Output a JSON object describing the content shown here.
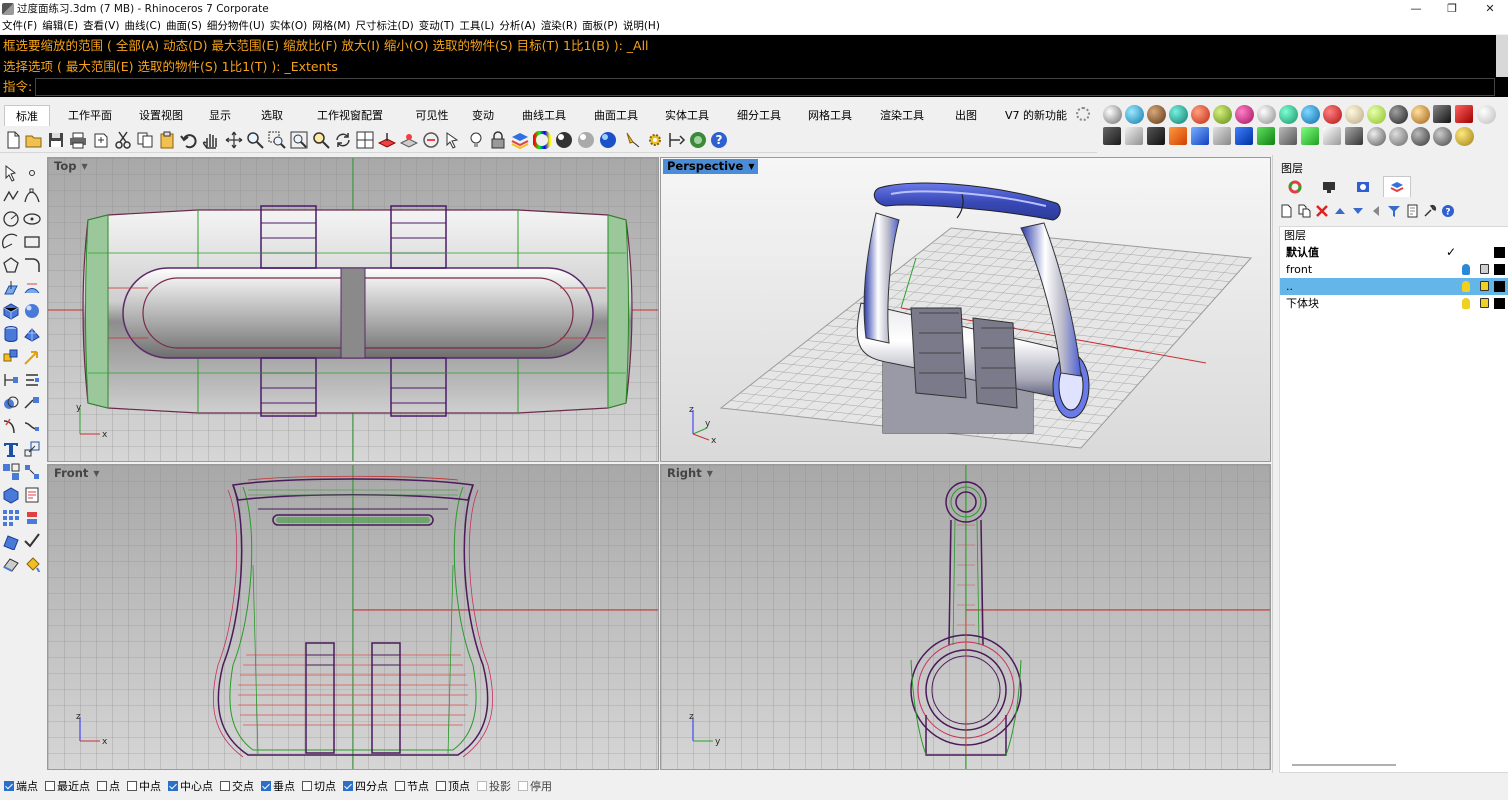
{
  "window": {
    "title": "过度面练习.3dm (7 MB) - Rhinoceros 7 Corporate",
    "controls": {
      "minimize": "—",
      "maximize": "❐",
      "close": "✕"
    }
  },
  "menu": [
    "文件(F)",
    "编辑(E)",
    "查看(V)",
    "曲线(C)",
    "曲面(S)",
    "细分物件(U)",
    "实体(O)",
    "网格(M)",
    "尺寸标注(D)",
    "变动(T)",
    "工具(L)",
    "分析(A)",
    "渲染(R)",
    "面板(P)",
    "说明(H)"
  ],
  "command": {
    "history": [
      "框选要缩放的范围 ( 全部(A)  动态(D)  最大范围(E)  缩放比(F)  放大(I)  缩小(O)  选取的物件(S)  目标(T)  1比1(B) ): _All",
      "选择选项 ( 最大范围(E)  选取的物件(S)  1比1(T) ): _Extents"
    ],
    "prompt": "指令:",
    "value": ""
  },
  "tabs": [
    {
      "label": "标准",
      "active": true
    },
    {
      "label": "工作平面",
      "active": false
    },
    {
      "label": "设置视图",
      "active": false
    },
    {
      "label": "显示",
      "active": false
    },
    {
      "label": "选取",
      "active": false
    },
    {
      "label": "工作视窗配置",
      "active": false
    },
    {
      "label": "可见性",
      "active": false
    },
    {
      "label": "变动",
      "active": false
    },
    {
      "label": "曲线工具",
      "active": false
    },
    {
      "label": "曲面工具",
      "active": false
    },
    {
      "label": "实体工具",
      "active": false
    },
    {
      "label": "细分工具",
      "active": false
    },
    {
      "label": "网格工具",
      "active": false
    },
    {
      "label": "渲染工具",
      "active": false
    },
    {
      "label": "出图",
      "active": false
    },
    {
      "label": "V7 的新功能",
      "active": false
    }
  ],
  "viewports": {
    "top": {
      "label": "Top",
      "x_axis": "x",
      "y_axis": "y"
    },
    "perspective": {
      "label": "Perspective",
      "x_axis": "x",
      "y_axis": "y",
      "z_axis": "z"
    },
    "front": {
      "label": "Front",
      "x_axis": "x",
      "z_axis": "z"
    },
    "right": {
      "label": "Right",
      "y_axis": "y",
      "z_axis": "z"
    }
  },
  "layers_panel": {
    "title": "图层",
    "column_header": "图层",
    "rows": [
      {
        "name": "默认值",
        "current": true,
        "bold": true,
        "selected": false,
        "bulb_color": "",
        "lock": false
      },
      {
        "name": "front",
        "current": false,
        "bold": false,
        "selected": false,
        "bulb_color": "#2a8ad8",
        "lock": true
      },
      {
        "name": "..",
        "current": false,
        "bold": false,
        "selected": true,
        "bulb_color": "#f0d020",
        "lock": false
      },
      {
        "name": "下体块",
        "current": false,
        "bold": false,
        "selected": false,
        "bulb_color": "#f0d020",
        "lock": false
      }
    ],
    "current_mark": "✓"
  },
  "snaps": [
    {
      "label": "端点",
      "checked": true,
      "enabled": true
    },
    {
      "label": "最近点",
      "checked": false,
      "enabled": true
    },
    {
      "label": "点",
      "checked": false,
      "enabled": true
    },
    {
      "label": "中点",
      "checked": false,
      "enabled": true
    },
    {
      "label": "中心点",
      "checked": true,
      "enabled": true
    },
    {
      "label": "交点",
      "checked": false,
      "enabled": true
    },
    {
      "label": "垂点",
      "checked": true,
      "enabled": true
    },
    {
      "label": "切点",
      "checked": false,
      "enabled": true
    },
    {
      "label": "四分点",
      "checked": true,
      "enabled": true
    },
    {
      "label": "节点",
      "checked": false,
      "enabled": true
    },
    {
      "label": "顶点",
      "checked": false,
      "enabled": true
    },
    {
      "label": "投影",
      "checked": false,
      "enabled": false
    },
    {
      "label": "停用",
      "checked": false,
      "enabled": false
    }
  ],
  "colors": {
    "command_text": "#f5a21a",
    "active_viewport": "#4a8cd6",
    "selected_layer": "#64b5e8",
    "model_blue": "#4a5fd8",
    "grid_axis_red": "#c83030",
    "grid_axis_green": "#2ea02e"
  }
}
